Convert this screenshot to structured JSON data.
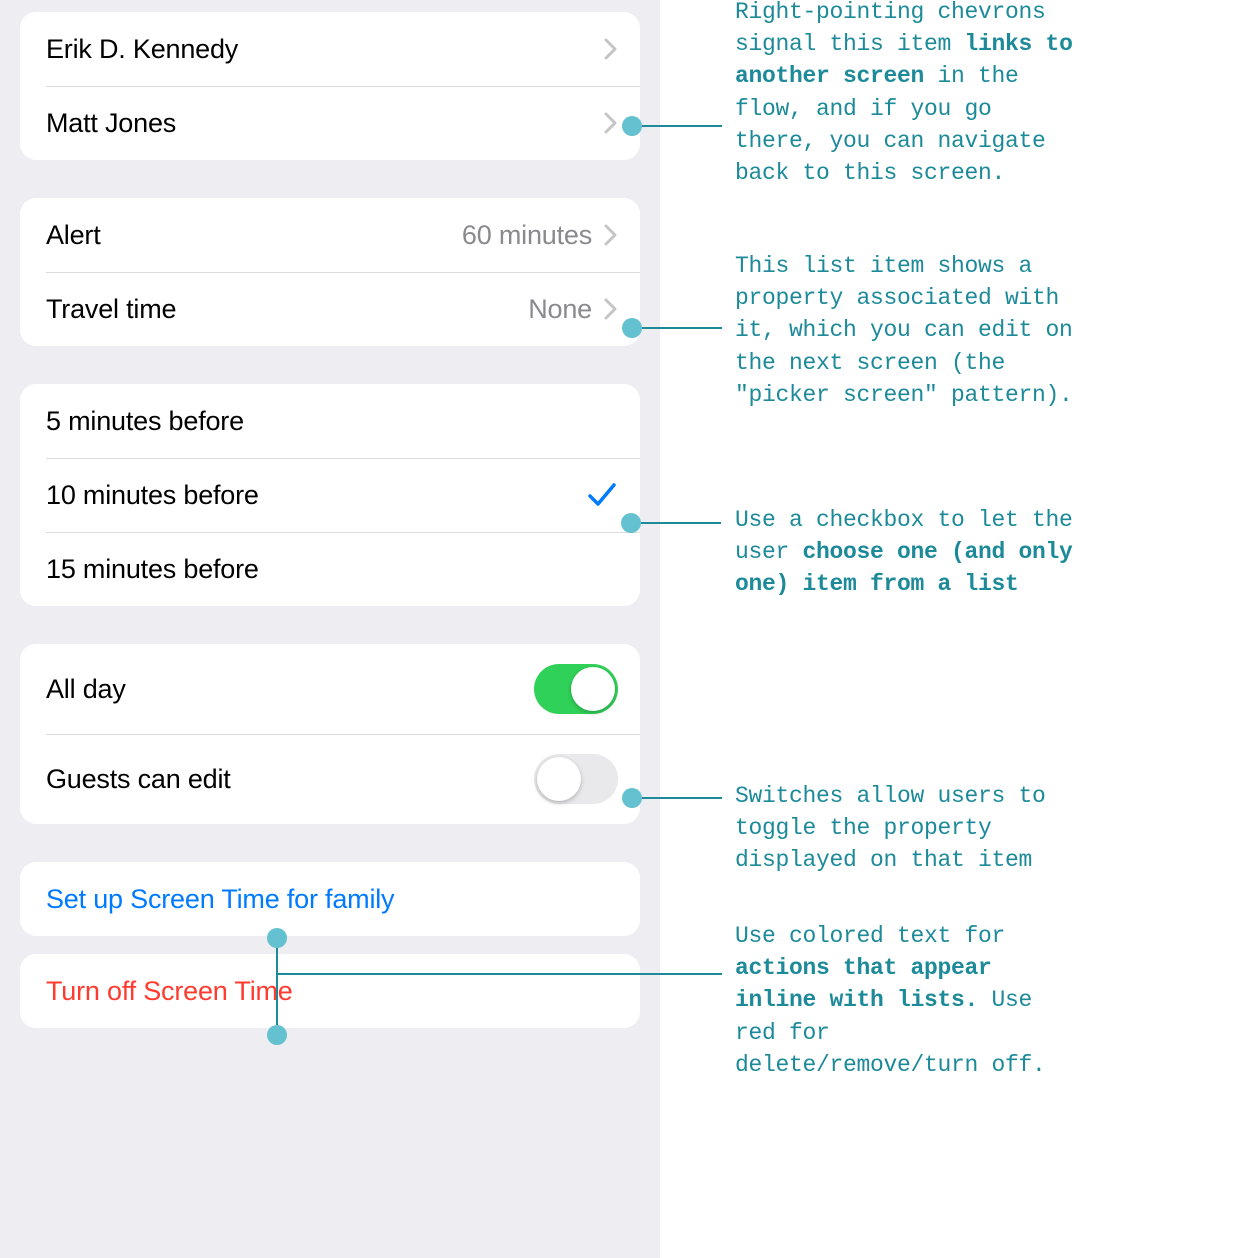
{
  "groups": {
    "people": {
      "items": [
        {
          "label": "Erik D. Kennedy"
        },
        {
          "label": "Matt Jones"
        }
      ]
    },
    "detail": {
      "items": [
        {
          "label": "Alert",
          "value": "60 minutes"
        },
        {
          "label": "Travel time",
          "value": "None"
        }
      ]
    },
    "picker": {
      "items": [
        {
          "label": "5 minutes before",
          "selected": false
        },
        {
          "label": "10 minutes before",
          "selected": true
        },
        {
          "label": "15 minutes before",
          "selected": false
        }
      ]
    },
    "toggles": {
      "items": [
        {
          "label": "All day",
          "on": true
        },
        {
          "label": "Guests can edit",
          "on": false
        }
      ]
    },
    "actions": {
      "primary": "Set up Screen Time for family",
      "destructive": "Turn off Screen Time"
    }
  },
  "annotations": {
    "a1": {
      "pre": "Right-pointing chevrons signal this item ",
      "bold": "links to another screen",
      "post": " in the flow, and if you go there, you can navigate back to this screen."
    },
    "a2": {
      "text": "This list item shows a property associated with it, which you can edit on the next screen (the \"picker screen\" pattern)."
    },
    "a3": {
      "pre": "Use a checkbox to let the user ",
      "bold": "choose one (and only one) item from a list"
    },
    "a4": {
      "text": "Switches allow users to toggle the property displayed on that item"
    },
    "a5": {
      "pre": "Use colored text for ",
      "bold": "actions that appear inline with lists.",
      "post": " Use red for delete/remove/turn off."
    }
  }
}
